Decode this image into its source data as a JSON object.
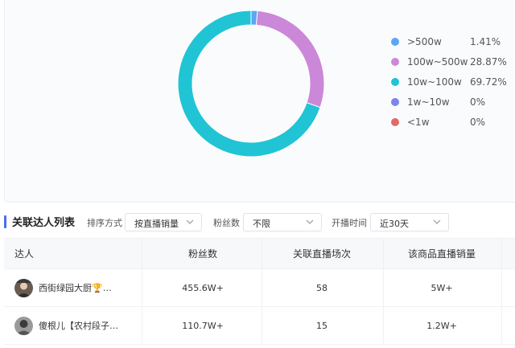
{
  "chart_data": {
    "type": "pie",
    "categories": [
      ">500w",
      "100w~500w",
      "10w~100w",
      "1w~10w",
      "<1w"
    ],
    "values": [
      1.41,
      28.87,
      69.72,
      0,
      0
    ],
    "value_labels": [
      "1.41%",
      "28.87%",
      "69.72%",
      "0%",
      "0%"
    ],
    "colors": [
      "#5ba6f5",
      "#cc88d8",
      "#21c4d5",
      "#7b86ea",
      "#e06a6a"
    ],
    "legend": "right"
  },
  "section": {
    "title": "关联达人列表"
  },
  "filters": [
    {
      "label": "排序方式",
      "value": "按直播销量"
    },
    {
      "label": "粉丝数",
      "value": "不限"
    },
    {
      "label": "开播时间",
      "value": "近30天"
    }
  ],
  "table": {
    "headers": [
      "达人",
      "粉丝数",
      "关联直播场次",
      "该商品直播销量"
    ],
    "rows": [
      {
        "name": "西街绿园大厨🏆…",
        "fans": "455.6W+",
        "sessions": "58",
        "sales": "5W+"
      },
      {
        "name": "傻根儿【农村段子…",
        "fans": "110.7W+",
        "sessions": "15",
        "sales": "1.2W+"
      }
    ]
  }
}
